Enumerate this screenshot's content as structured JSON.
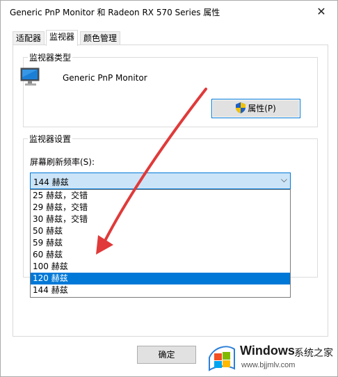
{
  "window": {
    "title": "Generic PnP Monitor 和 Radeon RX 570 Series 属性",
    "close_glyph": "✕"
  },
  "tabs": [
    {
      "label": "适配器",
      "active": false
    },
    {
      "label": "监视器",
      "active": true
    },
    {
      "label": "颜色管理",
      "active": false
    }
  ],
  "monitor_type": {
    "group_label": "监视器类型",
    "monitor_name": "Generic PnP Monitor",
    "properties_button": "属性(P)",
    "icon": "monitor-icon"
  },
  "monitor_settings": {
    "group_label": "监视器设置",
    "rate_label": "屏幕刷新频率(S):",
    "selected_value": "144 赫兹",
    "options": [
      {
        "label": "25 赫兹，交错",
        "selected": false
      },
      {
        "label": "29 赫兹，交错",
        "selected": false
      },
      {
        "label": "30 赫兹，交错",
        "selected": false
      },
      {
        "label": "50 赫兹",
        "selected": false
      },
      {
        "label": "59 赫兹",
        "selected": false
      },
      {
        "label": "60 赫兹",
        "selected": false
      },
      {
        "label": "100 赫兹",
        "selected": false
      },
      {
        "label": "120 赫兹",
        "selected": true
      },
      {
        "label": "144 赫兹",
        "selected": false
      }
    ]
  },
  "footer": {
    "ok_button": "确定"
  },
  "watermark": {
    "brand": "Windows",
    "brand_cn": "系统之家",
    "url": "www.bjjmlv.com"
  },
  "colors": {
    "accent": "#0078d7",
    "selection_bg": "#0078d7",
    "combo_bg": "#cce4f7",
    "annotation_arrow": "#e03a3a"
  }
}
